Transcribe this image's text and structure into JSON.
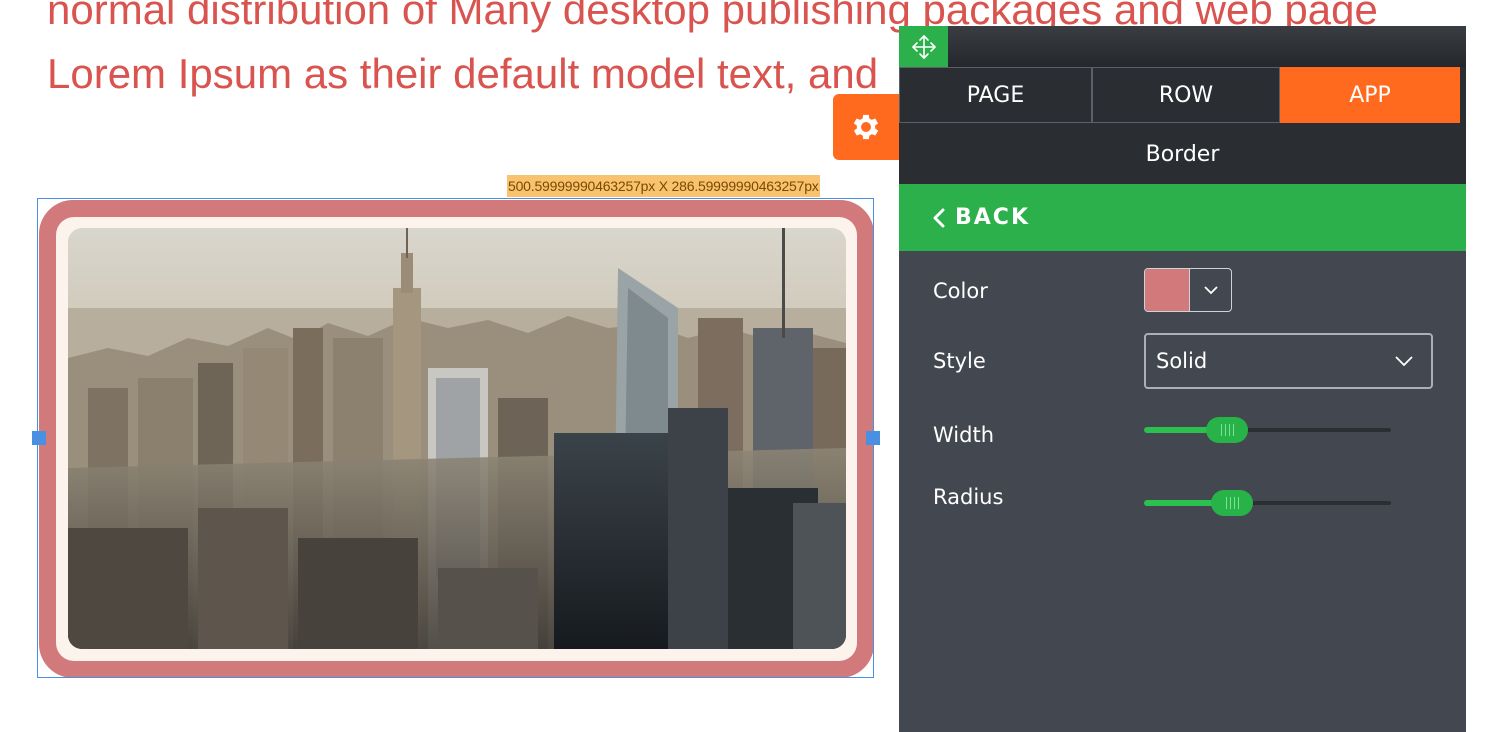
{
  "page": {
    "text_lines": [
      "normal distribution of Many desktop publishing packages and web page",
      "Lorem Ipsum as their default model text, and"
    ]
  },
  "selection": {
    "size_label": "500.59999990463257px X 286.59999990463257px"
  },
  "panel": {
    "tabs": [
      {
        "label": "PAGE",
        "active": false
      },
      {
        "label": "ROW",
        "active": false
      },
      {
        "label": "APP",
        "active": true
      }
    ],
    "section_title": "Border",
    "back_label": "BACK",
    "fields": {
      "color": {
        "label": "Color",
        "value": "#d27a7b"
      },
      "style": {
        "label": "Style",
        "value": "Solid"
      },
      "width": {
        "label": "Width",
        "value_fraction": 0.26
      },
      "radius": {
        "label": "Radius",
        "value_fraction": 0.28
      }
    }
  },
  "colors": {
    "accent_orange": "#ff6a1e",
    "accent_green": "#2cb04b",
    "panel_bg": "#434850",
    "selection_blue": "#4a90e2",
    "page_text": "#d9534f"
  },
  "icons": {
    "gear": "gear-icon",
    "move": "move-arrows-icon",
    "back": "chevron-left-icon",
    "color_dropdown": "chevron-down-icon",
    "style_dropdown": "chevron-down-icon"
  }
}
